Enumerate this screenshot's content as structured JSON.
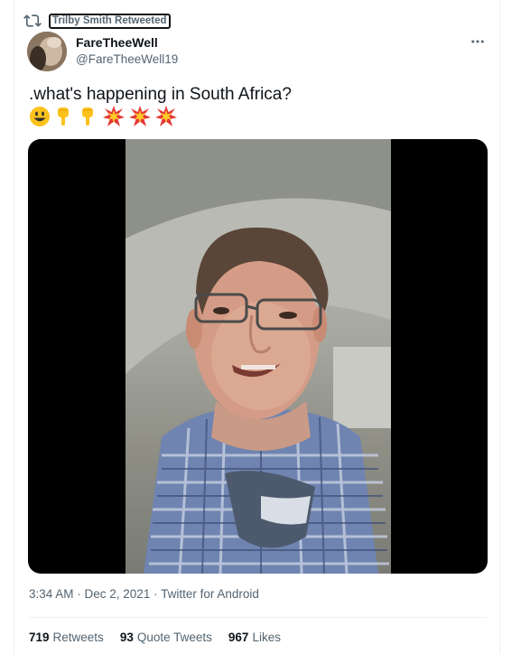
{
  "retweet": {
    "label": "Trilby Smith Retweeted",
    "icon": "retweet-icon"
  },
  "author": {
    "display_name": "FareTheeWell",
    "handle": "@FareTheeWell19",
    "avatar_icon": "avatar-photo"
  },
  "tweet": {
    "text": ".what's happening in South Africa?",
    "emojis": [
      "smiling-face-emoji",
      "pointing-down-emoji",
      "pointing-down-emoji",
      "collision-emoji",
      "collision-emoji",
      "collision-emoji"
    ],
    "media_description_icon": "video-thumbnail"
  },
  "meta": {
    "timestamp": "3:34 AM · Dec 2, 2021 · Twitter for Android"
  },
  "stats": {
    "retweets_count": "719",
    "retweets_label": "Retweets",
    "quotes_count": "93",
    "quotes_label": "Quote Tweets",
    "likes_count": "967",
    "likes_label": "Likes"
  },
  "colors": {
    "text_primary": "#0f1419",
    "text_secondary": "#536471",
    "border": "#eff3f4",
    "media_bg": "#000000"
  }
}
